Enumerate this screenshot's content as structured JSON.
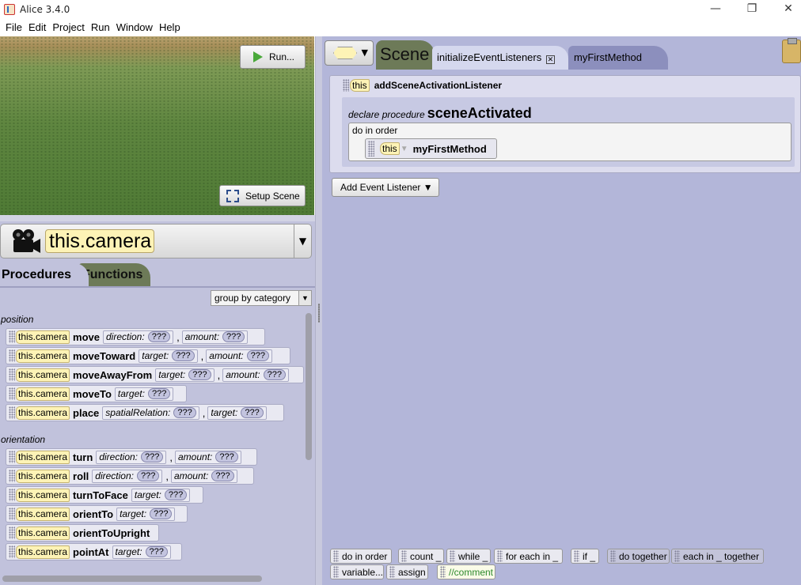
{
  "window": {
    "title": "Alice 3.4.0",
    "controls": [
      "—",
      "❐",
      "✕"
    ]
  },
  "menu": [
    "File",
    "Edit",
    "Project",
    "Run",
    "Window",
    "Help"
  ],
  "scene_view": {
    "run_label": "Run...",
    "setup_label": "Setup Scene"
  },
  "selector": {
    "instance": "this.camera"
  },
  "palette": {
    "tabs": {
      "procedures": "Procedures",
      "functions": "Functions"
    },
    "group_by": "group by category",
    "categories": [
      {
        "name": "position"
      },
      {
        "name": "orientation"
      }
    ],
    "this_label": "this.camera",
    "q": "???",
    "rows": [
      {
        "method": "move",
        "p1": "direction:",
        "p2": "amount:"
      },
      {
        "method": "moveToward",
        "p1": "target:",
        "p2": "amount:"
      },
      {
        "method": "moveAwayFrom",
        "p1": "target:",
        "p2": "amount:"
      },
      {
        "method": "moveTo",
        "p1": "target:"
      },
      {
        "method": "place",
        "p1": "spatialRelation:",
        "p2": "target:"
      },
      {
        "method": "turn",
        "p1": "direction:",
        "p2": "amount:"
      },
      {
        "method": "roll",
        "p1": "direction:",
        "p2": "amount:"
      },
      {
        "method": "turnToFace",
        "p1": "target:"
      },
      {
        "method": "orientTo",
        "p1": "target:"
      },
      {
        "method": "orientToUpright"
      },
      {
        "method": "pointAt",
        "p1": "target:"
      }
    ]
  },
  "editor": {
    "scene_tab": "Scene",
    "tabs": [
      {
        "label": "initializeEventListeners",
        "active": true
      },
      {
        "label": "myFirstMethod",
        "active": false
      }
    ],
    "listener": {
      "this_label": "this",
      "method": "addSceneActivationListener",
      "declare_prefix": "declare procedure",
      "declare_name": "sceneActivated",
      "do_in_order": "do in order",
      "statement_this": "this",
      "statement_method": "myFirstMethod"
    },
    "add_listener": "Add Event Listener ▼"
  },
  "control_tiles": [
    "do in order",
    "count _",
    "while _",
    "for each in _",
    "if _",
    "do together",
    "each in _ together",
    "variable...",
    "assign",
    "//comment"
  ],
  "colors": {
    "editor_bg": "#b3b6d9",
    "palette_bg": "#c1c2dc",
    "instance_yellow": "#fdf3b6",
    "tab_olive": "#6d7a58",
    "run_green": "#49a83a"
  }
}
